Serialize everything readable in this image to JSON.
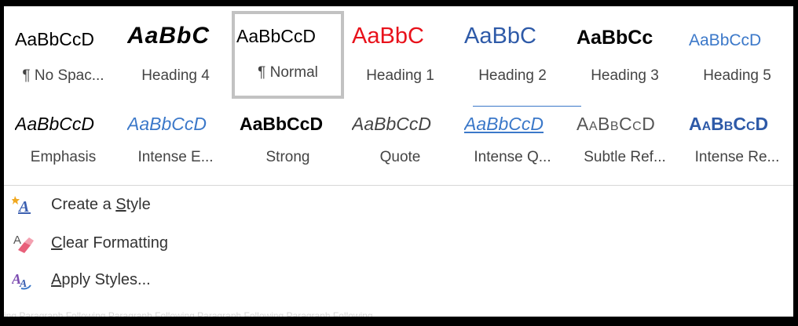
{
  "styles_row1": [
    {
      "sample": "AaBbCcD",
      "name": "¶ No Spac...",
      "sample_class": "s-nospacing"
    },
    {
      "sample": "AaBbC",
      "name": "Heading 4",
      "sample_class": "s-h4"
    },
    {
      "sample": "AaBbCcD",
      "name": "¶ Normal",
      "sample_class": "s-normal",
      "selected": true
    },
    {
      "sample": "AaBbC",
      "name": "Heading 1",
      "sample_class": "s-h1"
    },
    {
      "sample": "AaBbC",
      "name": "Heading 2",
      "sample_class": "s-h2"
    },
    {
      "sample": "AaBbCc",
      "name": "Heading 3",
      "sample_class": "s-h3"
    },
    {
      "sample": "AaBbCcD",
      "name": "Heading 5",
      "sample_class": "s-h5"
    }
  ],
  "styles_row2": [
    {
      "sample": "AaBbCcD",
      "name": "Emphasis",
      "sample_class": "s-emph"
    },
    {
      "sample": "AaBbCcD",
      "name": "Intense E...",
      "sample_class": "s-intE"
    },
    {
      "sample": "AaBbCcD",
      "name": "Strong",
      "sample_class": "s-strong"
    },
    {
      "sample": "AaBbCcD",
      "name": "Quote",
      "sample_class": "s-quote"
    },
    {
      "sample": "AaBbCcD",
      "name": "Intense Q...",
      "sample_class": "s-intQ"
    },
    {
      "sample": "AaBbCcD",
      "name": "Subtle Ref...",
      "sample_class": "s-subtle"
    },
    {
      "sample": "AaBbCcD",
      "name": "Intense Re...",
      "sample_class": "s-intR"
    }
  ],
  "commands": {
    "create_style": {
      "prefix": "Create a ",
      "ul": "S",
      "rest": "tyle",
      "icon": "create-style-icon"
    },
    "clear_formatting": {
      "prefix": "",
      "ul": "C",
      "rest": "lear Formatting",
      "icon": "clear-formatting-icon"
    },
    "apply_styles": {
      "prefix": "",
      "ul": "A",
      "rest": "pply Styles...",
      "icon": "apply-styles-icon"
    }
  },
  "background_text": "ing Paragraph Following Paragraph Following Paragraph Following Paragraph Following",
  "colors": {
    "heading1": "#e8121b",
    "heading2": "#2e5aa8",
    "accent_blue": "#3b78c9",
    "selection_border": "#c2c2c2"
  }
}
